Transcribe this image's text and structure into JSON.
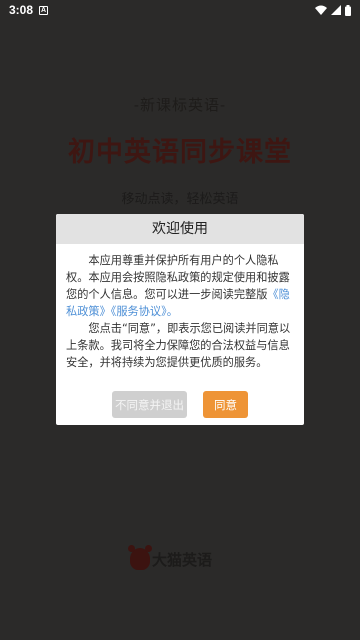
{
  "status_bar": {
    "time": "3:08",
    "notification_glyph": "A",
    "icons": [
      "wifi-icon",
      "signal-icon",
      "battery-icon"
    ]
  },
  "splash": {
    "subtitle": "-新课标英语-",
    "title": "初中英语同步课堂",
    "slogan": "移动点读，轻松英语",
    "brand_name": "大猫英语"
  },
  "dialog": {
    "title": "欢迎使用",
    "para1_text": "本应用尊重并保护所有用户的个人隐私权。本应用会按照隐私政策的规定使用和披露您的个人信息。您可以进一步阅读完整版",
    "privacy_link": "《隐私政策》",
    "service_link": "《服务协议》",
    "para1_end": "。",
    "para2_text": "您点击“同意”，即表示您已阅读并同意以上条款。我司将全力保障您的合法权益与信息安全，并将持续为您提供更优质的服务。",
    "decline_label": "不同意并退出",
    "accept_label": "同意"
  },
  "colors": {
    "overlay": "#2b2a29",
    "accent": "#ee9436",
    "link": "#4d8fd6",
    "header_bg": "#e2e2e2"
  }
}
